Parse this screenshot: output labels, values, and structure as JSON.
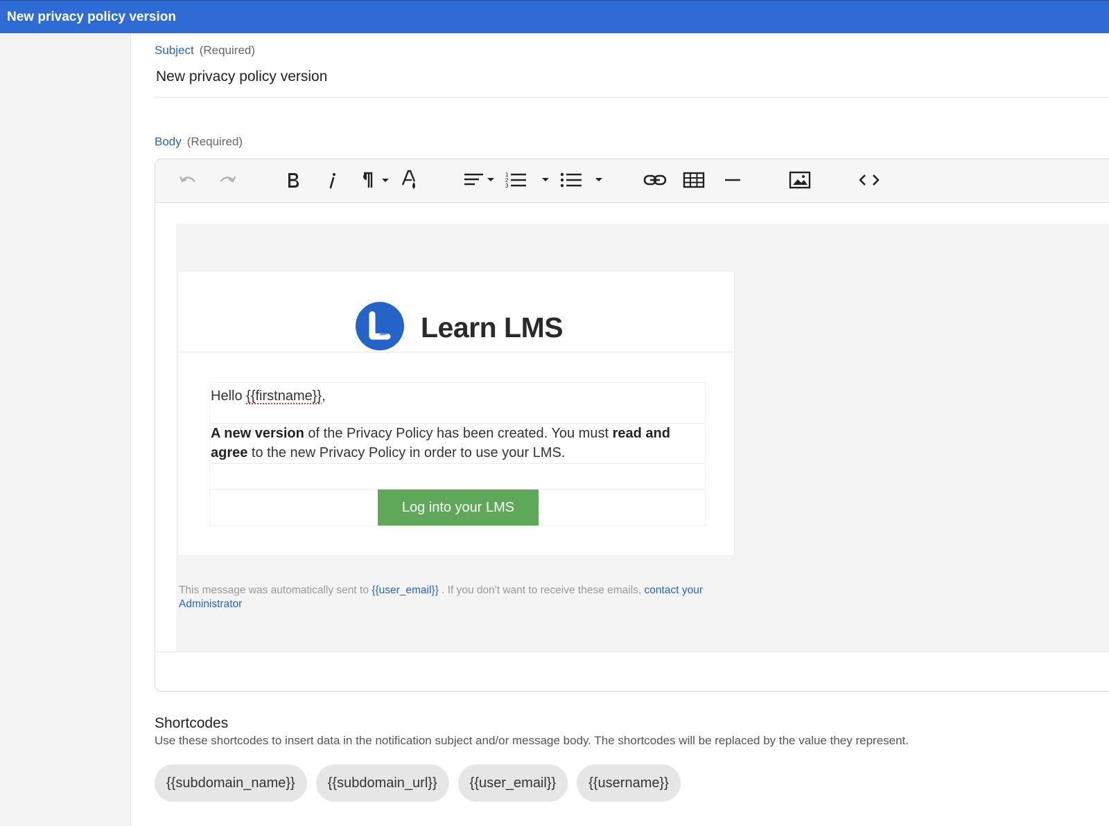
{
  "window": {
    "title": "New privacy policy version"
  },
  "form": {
    "subject": {
      "label": "Subject",
      "required": "(Required)",
      "value": "New privacy policy version"
    },
    "body": {
      "label": "Body",
      "required": "(Required)"
    }
  },
  "toolbar": {
    "items": [
      "undo-icon",
      "redo-icon",
      "bold-icon",
      "italic-icon",
      "paragraph-format-icon",
      "text-color-icon",
      "align-icon",
      "ordered-list-icon",
      "unordered-list-icon",
      "link-icon",
      "table-icon",
      "horizontal-line-icon",
      "image-icon",
      "code-view-icon"
    ]
  },
  "email": {
    "brand": "Learn LMS",
    "greeting_prefix": "Hello ",
    "greeting_var": "{{firstname}}",
    "greeting_suffix": ",",
    "para_bold1": "A new version",
    "para_text1": " of the Privacy Policy has been created. You must ",
    "para_bold2": "read and agree",
    "para_text2": " to the new Privacy Policy in order to use your LMS.",
    "cta_label": "Log into your LMS",
    "footer_text1": "This message was automatically sent to ",
    "footer_var": "{{user_email}}",
    "footer_text2": " . If you don't want to receive these emails, ",
    "footer_link": "contact your Administrator"
  },
  "shortcodes": {
    "title": "Shortcodes",
    "description": "Use these shortcodes to insert data in the notification subject and/or message body. The shortcodes will be replaced by the value they represent.",
    "items": [
      "{{subdomain_name}}",
      "{{subdomain_url}}",
      "{{user_email}}",
      "{{username}}"
    ]
  },
  "colors": {
    "topbar": "#2f6bd4",
    "accent": "#2563c9",
    "cta": "#5fa85a"
  }
}
